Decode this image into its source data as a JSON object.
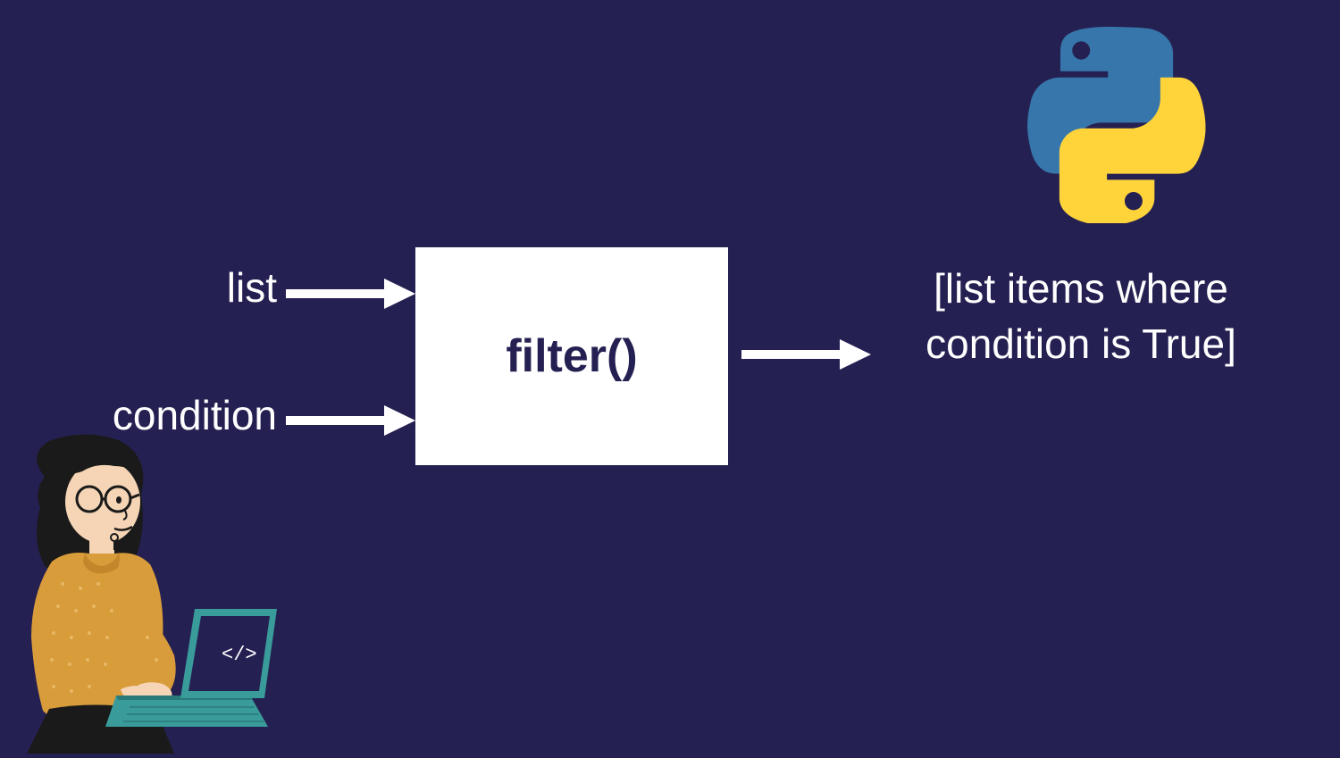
{
  "inputs": {
    "list_label": "list",
    "condition_label": "condition"
  },
  "box": {
    "function_name": "filter()"
  },
  "output": {
    "description": "[list items where condition is True]"
  },
  "icons": {
    "logo": "python-logo",
    "person": "person-with-laptop"
  }
}
